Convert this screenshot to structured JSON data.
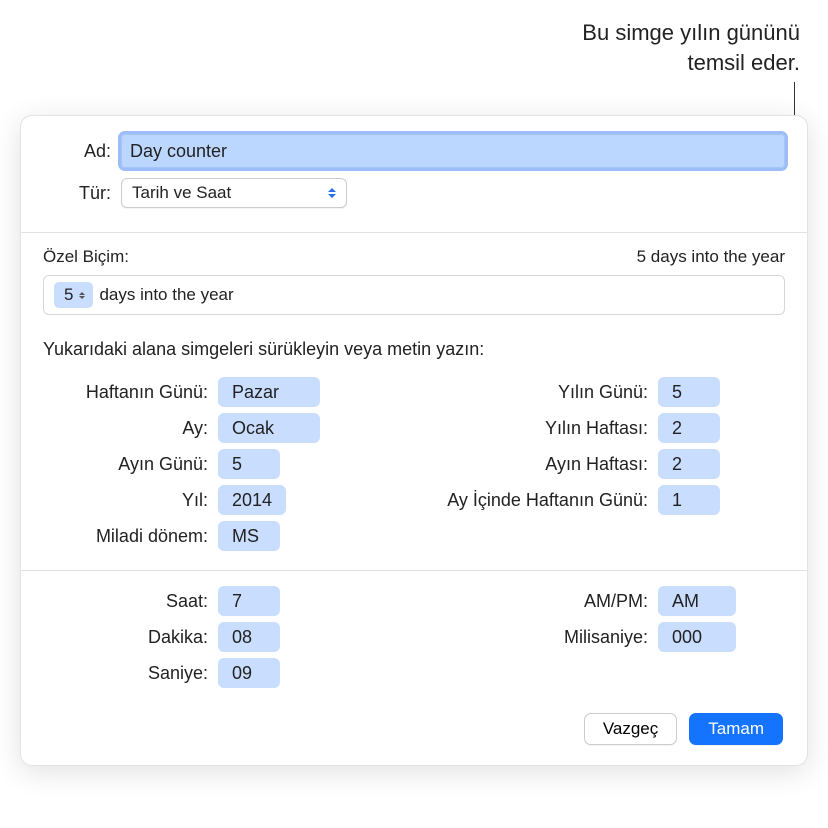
{
  "callout": {
    "line1": "Bu simge yılın gününü",
    "line2": "temsil eder."
  },
  "form": {
    "nameLabel": "Ad:",
    "nameValue": "Day counter",
    "typeLabel": "Tür:",
    "typeValue": "Tarih ve Saat"
  },
  "customFormat": {
    "label": "Özel Biçim:",
    "preview": "5 days into the year",
    "tokenValue": "5",
    "trailingText": "days into the year"
  },
  "instruction": "Yukarıdaki alana simgeleri sürükleyin veya metin yazın:",
  "dateTokens": {
    "left": [
      {
        "label": "Haftanın Günü:",
        "value": "Pazar",
        "wide": true
      },
      {
        "label": "Ay:",
        "value": "Ocak",
        "wide": true
      },
      {
        "label": "Ayın Günü:",
        "value": "5"
      },
      {
        "label": "Yıl:",
        "value": "2014"
      },
      {
        "label": "Miladi dönem:",
        "value": "MS"
      }
    ],
    "right": [
      {
        "label": "Yılın Günü:",
        "value": "5"
      },
      {
        "label": "Yılın Haftası:",
        "value": "2"
      },
      {
        "label": "Ayın Haftası:",
        "value": "2"
      },
      {
        "label": "Ay İçinde Haftanın Günü:",
        "value": "1"
      }
    ]
  },
  "timeTokens": {
    "left": [
      {
        "label": "Saat:",
        "value": "7"
      },
      {
        "label": "Dakika:",
        "value": "08"
      },
      {
        "label": "Saniye:",
        "value": "09"
      }
    ],
    "right": [
      {
        "label": "AM/PM:",
        "value": "AM"
      },
      {
        "label": "Milisaniye:",
        "value": "000"
      }
    ]
  },
  "buttons": {
    "cancel": "Vazgeç",
    "ok": "Tamam"
  }
}
